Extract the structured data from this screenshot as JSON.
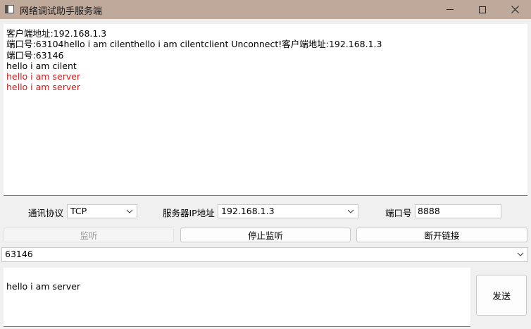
{
  "window": {
    "title": "网络调试助手服务端",
    "icon": "app-window-icon"
  },
  "log": {
    "lines": [
      {
        "text": "客户端地址:192.168.1.3",
        "kind": "info"
      },
      {
        "text": "端口号:63104hello i am cilenthello i am cilentclient Unconnect!客户端地址:192.168.1.3",
        "kind": "info"
      },
      {
        "text": "端口号:63146",
        "kind": "info"
      },
      {
        "text": "hello i am cilent",
        "kind": "info"
      },
      {
        "text": "hello i am server",
        "kind": "server"
      },
      {
        "text": "hello i am server",
        "kind": "server"
      }
    ],
    "server_color": "#c81e1e"
  },
  "config": {
    "protocol_label": "通讯协议",
    "protocol_value": "TCP",
    "ip_label": "服务器IP地址",
    "ip_value": "192.168.1.3",
    "port_label": "端口号",
    "port_value": "8888"
  },
  "actions": {
    "listen_label": "监听",
    "stop_listen_label": "停止监听",
    "disconnect_label": "断开链接"
  },
  "client_select": {
    "value": "63146"
  },
  "send": {
    "message": "hello i am server",
    "send_label": "发送"
  },
  "colors": {
    "titlebar": "#bfa99b"
  }
}
